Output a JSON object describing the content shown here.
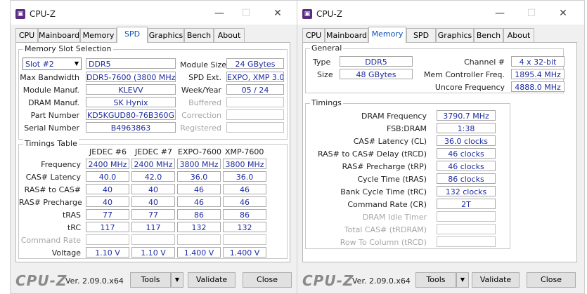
{
  "app_title": "CPU-Z",
  "tabs": [
    "CPU",
    "Mainboard",
    "Memory",
    "SPD",
    "Graphics",
    "Bench",
    "About"
  ],
  "spd": {
    "group_slot_title": "Memory Slot Selection",
    "slot_value": "Slot #2",
    "type_value": "DDR5",
    "module_size_label": "Module Size",
    "module_size_value": "24 GBytes",
    "max_bw_label": "Max Bandwidth",
    "max_bw_value": "DDR5-7600 (3800 MHz)",
    "spd_ext_label": "SPD Ext.",
    "spd_ext_value": "EXPO, XMP 3.0",
    "module_manuf_label": "Module Manuf.",
    "module_manuf_value": "KLEVV",
    "week_year_label": "Week/Year",
    "week_year_value": "05 / 24",
    "dram_manuf_label": "DRAM Manuf.",
    "dram_manuf_value": "SK Hynix",
    "buffered_label": "Buffered",
    "part_number_label": "Part Number",
    "part_number_value": "KD5KGUD80-76B360G",
    "correction_label": "Correction",
    "serial_label": "Serial Number",
    "serial_value": "B4963863",
    "registered_label": "Registered",
    "timings_title": "Timings Table",
    "columns": [
      "JEDEC #6",
      "JEDEC #7",
      "EXPO-7600",
      "XMP-7600"
    ],
    "rows": [
      {
        "label": "Frequency",
        "values": [
          "2400 MHz",
          "2400 MHz",
          "3800 MHz",
          "3800 MHz"
        ]
      },
      {
        "label": "CAS# Latency",
        "values": [
          "40.0",
          "42.0",
          "36.0",
          "36.0"
        ]
      },
      {
        "label": "RAS# to CAS#",
        "values": [
          "40",
          "40",
          "46",
          "46"
        ]
      },
      {
        "label": "RAS# Precharge",
        "values": [
          "40",
          "40",
          "46",
          "46"
        ]
      },
      {
        "label": "tRAS",
        "values": [
          "77",
          "77",
          "86",
          "86"
        ]
      },
      {
        "label": "tRC",
        "values": [
          "117",
          "117",
          "132",
          "132"
        ]
      },
      {
        "label": "Command Rate",
        "values": [
          "",
          "",
          "",
          ""
        ]
      },
      {
        "label": "Voltage",
        "values": [
          "1.10 V",
          "1.10 V",
          "1.400 V",
          "1.400 V"
        ]
      }
    ]
  },
  "memory": {
    "general_title": "General",
    "type_label": "Type",
    "type_value": "DDR5",
    "size_label": "Size",
    "size_value": "48 GBytes",
    "channel_label": "Channel #",
    "channel_value": "4 x 32-bit",
    "mc_freq_label": "Mem Controller Freq.",
    "mc_freq_value": "1895.4 MHz",
    "uncore_label": "Uncore Frequency",
    "uncore_value": "4888.0 MHz",
    "timings_title": "Timings",
    "rows": [
      {
        "label": "DRAM Frequency",
        "value": "3790.7 MHz"
      },
      {
        "label": "FSB:DRAM",
        "value": "1:38"
      },
      {
        "label": "CAS# Latency (CL)",
        "value": "36.0 clocks"
      },
      {
        "label": "RAS# to CAS# Delay (tRCD)",
        "value": "46 clocks"
      },
      {
        "label": "RAS# Precharge (tRP)",
        "value": "46 clocks"
      },
      {
        "label": "Cycle Time (tRAS)",
        "value": "86 clocks"
      },
      {
        "label": "Bank Cycle Time (tRC)",
        "value": "132 clocks"
      },
      {
        "label": "Command Rate (CR)",
        "value": "2T"
      },
      {
        "label": "DRAM Idle Timer",
        "value": ""
      },
      {
        "label": "Total CAS# (tRDRAM)",
        "value": ""
      },
      {
        "label": "Row To Column (tRCD)",
        "value": ""
      }
    ]
  },
  "bottom": {
    "brand": "CPU-Z",
    "version": "Ver. 2.09.0.x64",
    "tools": "Tools",
    "validate": "Validate",
    "close": "Close"
  },
  "titlebar": {
    "minimize": "—",
    "maximize": "☐",
    "close": "✕"
  }
}
